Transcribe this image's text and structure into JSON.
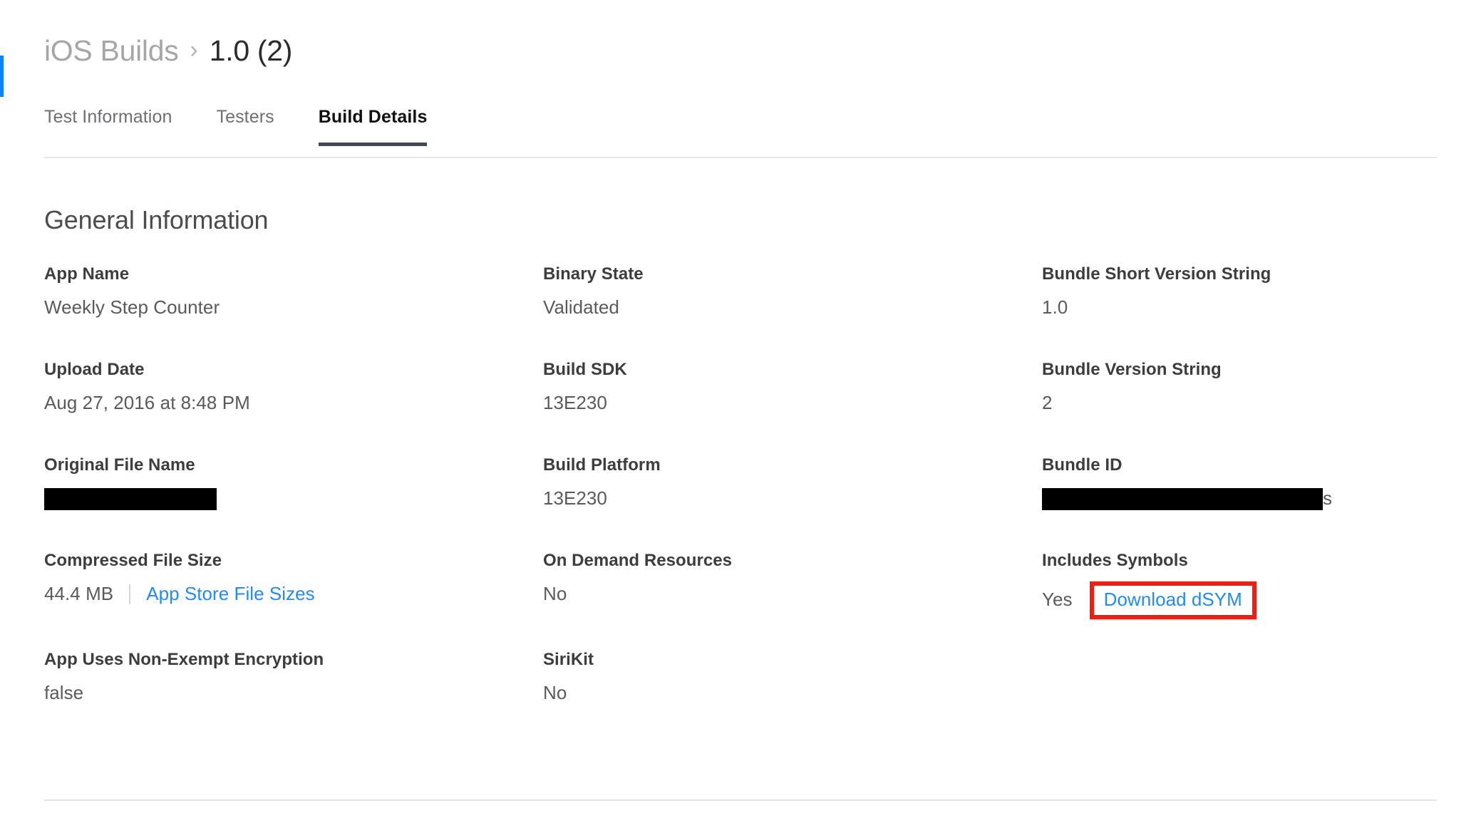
{
  "breadcrumb": {
    "parent": "iOS Builds",
    "separator": "›",
    "current": "1.0 (2)"
  },
  "tabs": [
    {
      "label": "Test Information",
      "active": false
    },
    {
      "label": "Testers",
      "active": false
    },
    {
      "label": "Build Details",
      "active": true
    }
  ],
  "section": {
    "title": "General Information"
  },
  "fields": {
    "app_name": {
      "label": "App Name",
      "value": "Weekly Step Counter"
    },
    "binary_state": {
      "label": "Binary State",
      "value": "Validated"
    },
    "bundle_short_version_string": {
      "label": "Bundle Short Version String",
      "value": "1.0"
    },
    "upload_date": {
      "label": "Upload Date",
      "value": "Aug 27, 2016 at 8:48 PM"
    },
    "build_sdk": {
      "label": "Build SDK",
      "value": "13E230"
    },
    "bundle_version_string": {
      "label": "Bundle Version String",
      "value": "2"
    },
    "original_file_name": {
      "label": "Original File Name",
      "value": ""
    },
    "build_platform": {
      "label": "Build Platform",
      "value": "13E230"
    },
    "bundle_id": {
      "label": "Bundle ID",
      "value": "",
      "visible_tail": "s"
    },
    "compressed_file_size": {
      "label": "Compressed File Size",
      "value": "44.4 MB",
      "link_label": "App Store File Sizes"
    },
    "on_demand_resources": {
      "label": "On Demand Resources",
      "value": "No"
    },
    "includes_symbols": {
      "label": "Includes Symbols",
      "value": "Yes",
      "link_label": "Download dSYM"
    },
    "non_exempt_encryption": {
      "label": "App Uses Non-Exempt Encryption",
      "value": "false"
    },
    "sirikit": {
      "label": "SiriKit",
      "value": "No"
    }
  },
  "colors": {
    "link": "#1f8bff",
    "annotation": "#f41b10",
    "active_tab_underline": "#434a54",
    "left_accent": "#0a84ff",
    "redaction": "#000000"
  }
}
